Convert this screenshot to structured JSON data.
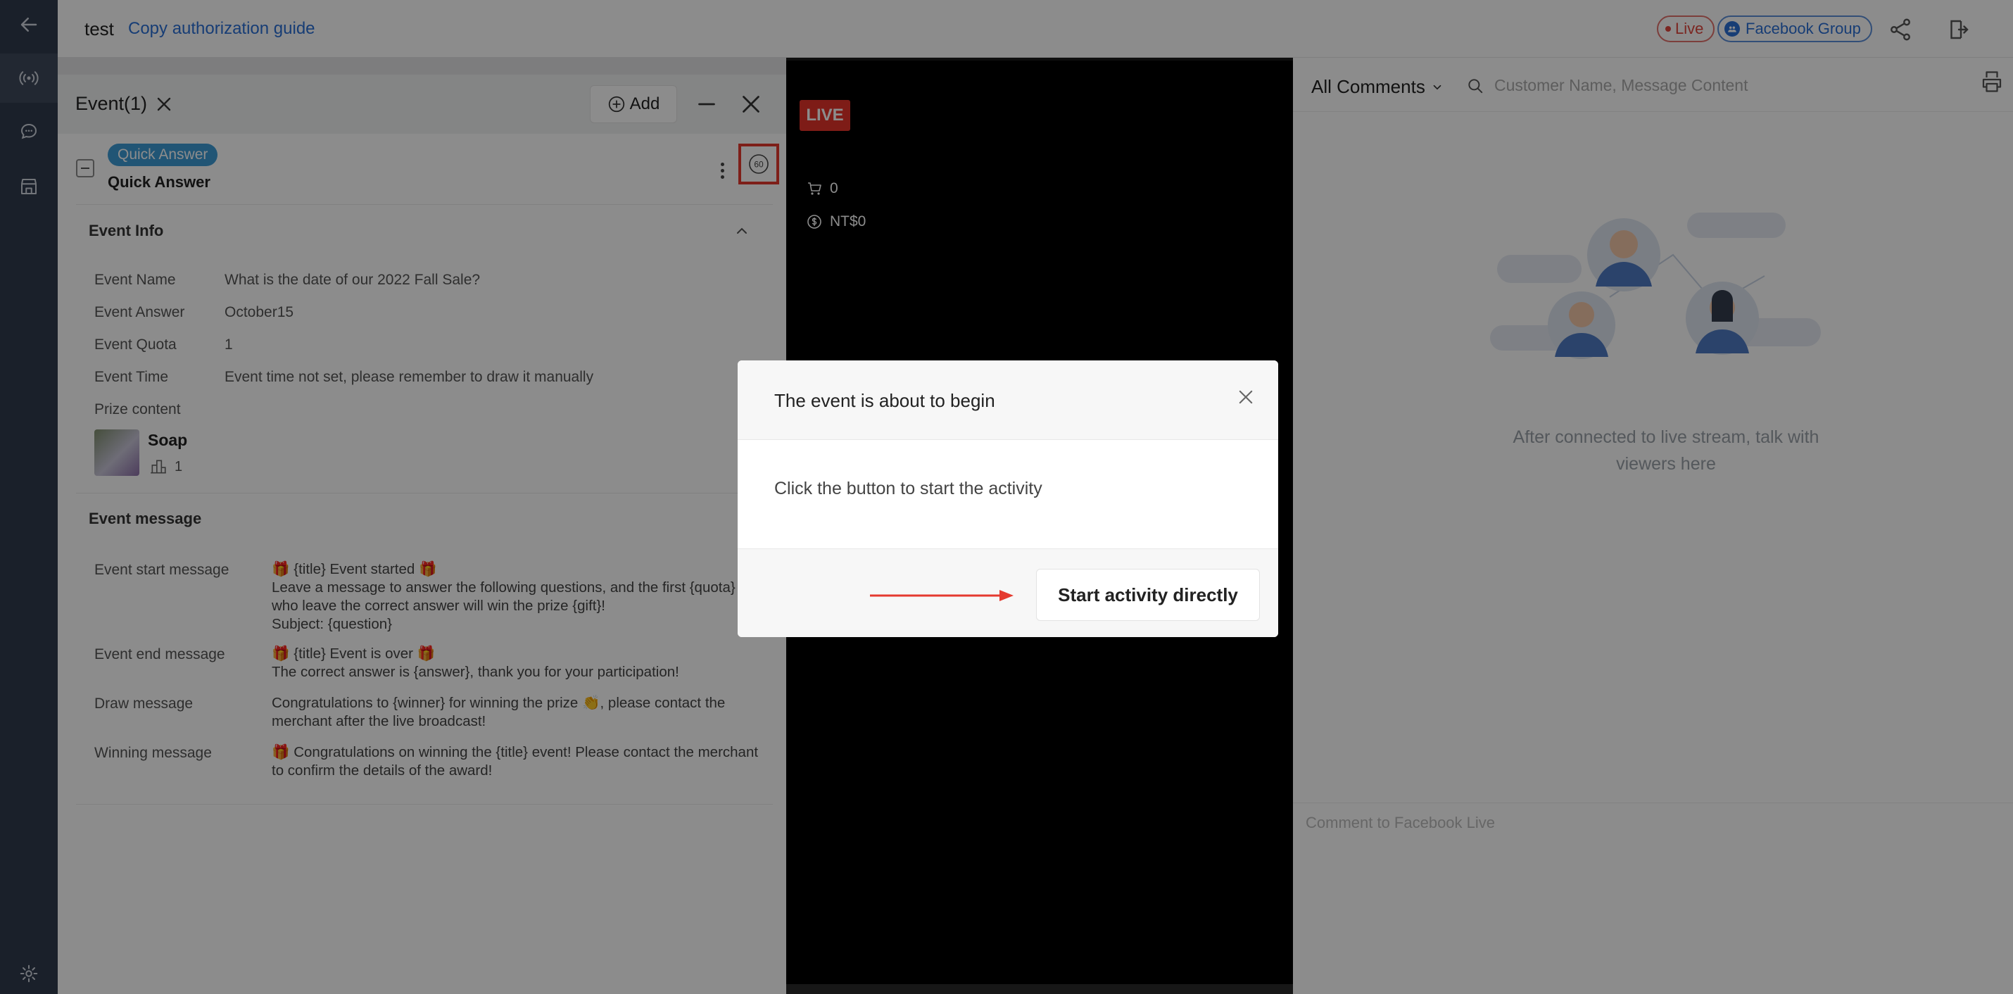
{
  "topbar": {
    "title": "test",
    "guide_link": "Copy authorization guide",
    "live_label": "Live",
    "platform_label": "Facebook Group"
  },
  "event_panel": {
    "title": "Event(1)",
    "add_label": "Add",
    "event": {
      "tag": "Quick Answer",
      "name": "Quick Answer",
      "timer_label": "60"
    },
    "info_section_title": "Event Info",
    "info": {
      "name_label": "Event Name",
      "name_value": "What is the date of our 2022 Fall Sale?",
      "answer_label": "Event Answer",
      "answer_value": "October15",
      "quota_label": "Event Quota",
      "quota_value": "1",
      "time_label": "Event Time",
      "time_value": "Event time not set, please remember to draw it manually",
      "prize_label": "Prize content",
      "prize_name": "Soap",
      "prize_qty": "1"
    },
    "message_section_title": "Event message",
    "messages": {
      "start_label": "Event start message",
      "start_value": "🎁 {title} Event started 🎁\nLeave a message to answer the following questions, and the first {quota} who leave the correct answer will win the prize {gift}!\nSubject: {question}",
      "end_label": "Event end message",
      "end_value": "🎁 {title} Event is over 🎁\nThe correct answer is {answer}, thank you for your participation!",
      "draw_label": "Draw message",
      "draw_value": "Congratulations to {winner} for winning the prize 👏, please contact the merchant after the live broadcast!",
      "winning_label": "Winning message",
      "winning_value": "🎁 Congratulations on winning the {title} event! Please contact the merchant to confirm the details of the award!"
    }
  },
  "video": {
    "live_tag": "LIVE",
    "cart_count": "0",
    "revenue": "NT$0"
  },
  "comments": {
    "filter_label": "All Comments",
    "search_placeholder": "Customer Name, Message Content",
    "empty_text": "After connected to live stream, talk with viewers here",
    "input_placeholder": "Comment to Facebook Live"
  },
  "modal": {
    "title": "The event is about to begin",
    "body": "Click the button to start the activity",
    "start_button": "Start activity directly"
  },
  "colors": {
    "sidebar": "#303b4d",
    "live_red": "#e5332a",
    "link_blue": "#2b6fd6",
    "tag_blue": "#3c9bd6"
  },
  "icons": {
    "back": "arrow-left-icon",
    "live": "broadcast-icon",
    "chat": "chat-bubble-icon",
    "store": "store-icon",
    "settings": "gear-icon",
    "share": "share-icon",
    "exit": "exit-icon",
    "print": "printer-icon"
  }
}
